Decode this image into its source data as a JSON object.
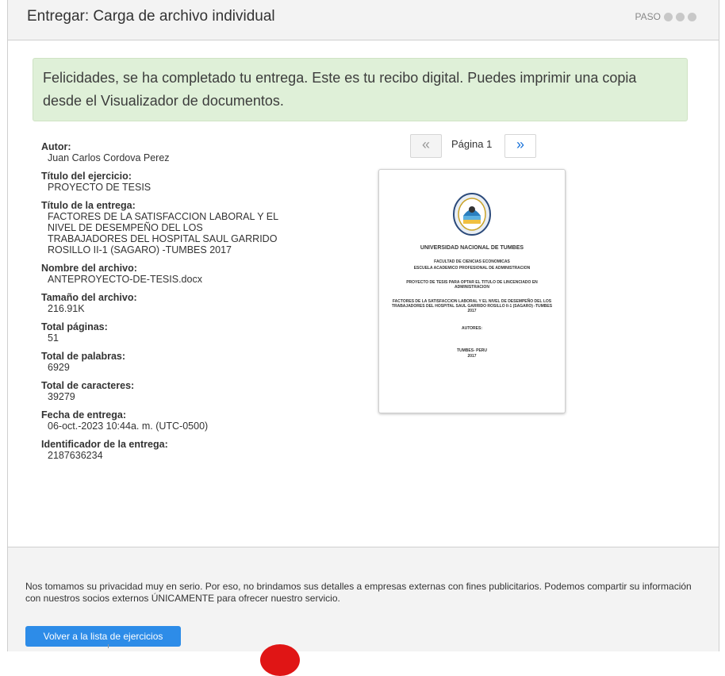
{
  "header": {
    "title": "Entregar: Carga de archivo individual",
    "step_label": "PASO"
  },
  "success": {
    "message": "Felicidades, se ha completado tu entrega. Este es tu recibo digital. Puedes imprimir una copia desde el Visualizador de documentos."
  },
  "details": [
    {
      "label": "Autor:",
      "value": "Juan Carlos Cordova Perez"
    },
    {
      "label": "Título del ejercicio:",
      "value": "PROYECTO DE TESIS"
    },
    {
      "label": "Título de la entrega:",
      "value": "FACTORES DE LA SATISFACCION LABORAL Y EL\nNIVEL DE DESEMPEÑO DEL LOS\nTRABAJADORES DEL HOSPITAL SAUL GARRIDO\nROSILLO II-1 (SAGARO) -TUMBES 2017"
    },
    {
      "label": "Nombre del archivo:",
      "value": "ANTEPROYECTO-DE-TESIS.docx"
    },
    {
      "label": "Tamaño del archivo:",
      "value": "216.91K"
    },
    {
      "label": "Total páginas:",
      "value": "51"
    },
    {
      "label": "Total de palabras:",
      "value": "6929"
    },
    {
      "label": "Total de caracteres:",
      "value": "39279"
    },
    {
      "label": "Fecha de entrega:",
      "value": "06-oct.-2023 10:44a. m. (UTC-0500)"
    },
    {
      "label": "Identificador de la entrega:",
      "value": "2187636234"
    }
  ],
  "pager": {
    "prev": "«",
    "page_label": "Página 1",
    "next": "»"
  },
  "document_preview": {
    "university": "UNIVERSIDAD NACIONAL DE TUMBES",
    "faculty": "FACULTAD DE CIENCIAS ECONOMICAS",
    "school": "ESCUELA ACADEMICO PROFESIONAL DE ADMINISTRACION",
    "purpose": "PROYECTO DE TESIS PARA OPTAR EL TITULO DE LINCENCIADO EN ADMINISTRACION",
    "title": "FACTORES DE LA SATISFACCION LABORAL Y EL NIVEL DE DESEMPEÑO DEL LOS TRABAJADORES DEL HOSPITAL SAUL GARRIDO ROSILLO II-1 (SAGARO) -TUMBES 2017",
    "authors": "AUTORES:",
    "place": "TUMBES- PERU",
    "year": "2017"
  },
  "footer": {
    "privacy": "Nos tomamos su privacidad muy en serio. Por eso, no brindamos sus detalles a empresas externas con fines publicitarios. Podemos compartir su información con nuestros socios externos ÚNICAMENTE para ofrecer nuestro servicio.",
    "back_button": "Volver a la lista de ejercicios"
  },
  "colors": {
    "success_bg": "#dff0d8",
    "primary": "#2d8ce8",
    "header_bg": "#f3f3f3"
  }
}
